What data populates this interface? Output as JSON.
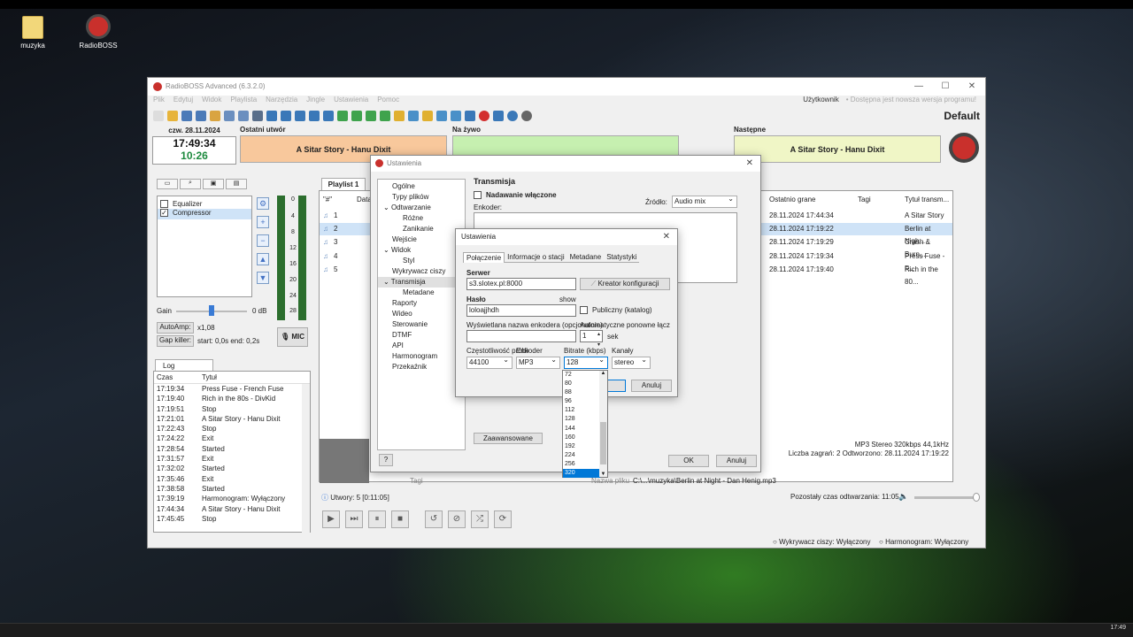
{
  "desktop": {
    "icons": [
      {
        "label": "muzyka"
      },
      {
        "label": "RadioBOSS"
      }
    ]
  },
  "taskbar": {
    "time": "17:49"
  },
  "app": {
    "title": "RadioBOSS Advanced (6.3.2.0)",
    "menu": [
      "Plik",
      "Edytuj",
      "Widok",
      "Playlista",
      "Narzędzia",
      "Jingle",
      "Ustawienia",
      "Pomoc"
    ],
    "user": "Użytkownik",
    "update": "• Dostępna jest nowsza wersja programu!",
    "profile": "Default",
    "date": "czw. 28.11.2024",
    "time": "17:49:34",
    "countdown": "10:26",
    "last_label": "Ostatni utwór",
    "last_track": "A Sitar Story - Hanu Dixit",
    "live_label": "Na żywo",
    "live_track": "",
    "next_label": "Następne",
    "next_track": "A Sitar Story - Hanu Dixit",
    "effects": [
      {
        "name": "Equalizer",
        "checked": false
      },
      {
        "name": "Compressor",
        "checked": true
      }
    ],
    "gain_label": "Gain",
    "gain_value": "0 dB",
    "autoamp_label": "AutoAmp:",
    "autoamp_value": "x1,08",
    "gapkiller_label": "Gap killer:",
    "gapkiller_value": "start: 0,0s end: 0,2s",
    "mic_label": "MIC",
    "meter_scale": [
      "0",
      "4",
      "8",
      "12",
      "16",
      "20",
      "24",
      "28"
    ],
    "log": {
      "tab": "Log",
      "col_time": "Czas",
      "col_title": "Tytuł",
      "rows": [
        {
          "t": "17:19:34",
          "v": "Press Fuse - French Fuse"
        },
        {
          "t": "17:19:40",
          "v": "Rich in the 80s - DivKid"
        },
        {
          "t": "17:19:51",
          "v": "Stop"
        },
        {
          "t": "17:21:01",
          "v": "A Sitar Story - Hanu Dixit"
        },
        {
          "t": "17:22:43",
          "v": "Stop"
        },
        {
          "t": "17:24:22",
          "v": "Exit"
        },
        {
          "t": "17:28:54",
          "v": "Started"
        },
        {
          "t": "17:31:57",
          "v": "Exit"
        },
        {
          "t": "17:32:02",
          "v": "Started"
        },
        {
          "t": "17:35:46",
          "v": "Exit"
        },
        {
          "t": "17:38:58",
          "v": "Started"
        },
        {
          "t": "17:39:19",
          "v": "Harmonogram: Wyłączony"
        },
        {
          "t": "17:44:34",
          "v": "A Sitar Story - Hanu Dixit"
        },
        {
          "t": "17:45:45",
          "v": "Stop"
        }
      ]
    },
    "playlist": {
      "tab": "Playlist 1",
      "col_num": "\"#\"",
      "col_data": "Data",
      "rows": [
        "1",
        "2",
        "3",
        "4",
        "5"
      ],
      "col_last": "Ostatnio grane",
      "col_tags": "Tagi",
      "col_title": "Tytuł transm...",
      "played": [
        {
          "d": "28.11.2024 17:44:34",
          "t": "A Sitar Story -..."
        },
        {
          "d": "28.11.2024 17:19:22",
          "t": "Berlin at Nigh..."
        },
        {
          "d": "28.11.2024 17:19:29",
          "t": "Crash & Burn..."
        },
        {
          "d": "28.11.2024 17:19:34",
          "t": "Press Fuse - F..."
        },
        {
          "d": "28.11.2024 17:19:40",
          "t": "Rich in the 80..."
        }
      ],
      "info1": "MP3 Stereo 320kbps 44,1kHz",
      "info2": "Liczba zagrań: 2  Odtworzono: 28.11.2024 17:19:22",
      "tags_label": "Tagi",
      "file_label": "Nazwa pliku",
      "file_path": "C:\\...\\muzyka\\Berlin at Night - Dan Henig.mp3"
    },
    "status": {
      "tracks": "Utwory: 5 [0:11:05]",
      "remaining": "Pozostały czas odtwarzania: 11:05",
      "silence": "Wykrywacz ciszy: Wyłączony",
      "schedule": "Harmonogram: Wyłączony"
    }
  },
  "settings": {
    "title": "Ustawienia",
    "tree": [
      "Ogólne",
      "Typy plików",
      "Odtwarzanie",
      "Różne",
      "Zanikanie",
      "Wejście",
      "Widok",
      "Styl",
      "Wykrywacz ciszy",
      "Transmisja",
      "Metadane",
      "Raporty",
      "Wideo",
      "Sterowanie",
      "DTMF",
      "API",
      "Harmonogram",
      "Przekaźnik"
    ],
    "section": "Transmisja",
    "enable_label": "Nadawanie włączone",
    "source_label": "Źródło:",
    "source_value": "Audio mix",
    "encoder_label": "Enkoder:",
    "advanced": "Zaawansowane",
    "help": "?",
    "ok": "OK",
    "cancel": "Anuluj"
  },
  "encoder": {
    "title": "Ustawienia",
    "tabs": [
      "Połączenie",
      "Informacje o stacji",
      "Metadane",
      "Statystyki"
    ],
    "server_label": "Serwer",
    "server_value": "s3.slotex.pl:8000",
    "wizard": "Kreator konfiguracji",
    "password_label": "Hasło",
    "password_value": "loloajjhdh",
    "show": "show",
    "public_label": "Publiczny (katalog)",
    "name_label": "Wyświetlana nazwa enkodera (opcjonalnie)",
    "reconnect_label": "Automatyczne ponowne łącz",
    "reconnect_value": "1",
    "reconnect_unit": "sek",
    "freq_label": "Częstotliwość próbkowania",
    "freq_value": "44100",
    "enc_label": "Enkoder",
    "enc_value": "MP3",
    "bitrate_label": "Bitrate (kbps)",
    "bitrate_value": "128",
    "channels_label": "Kanały",
    "channels_value": "stereo",
    "cancel": "Anuluj",
    "bitrates": [
      "72",
      "80",
      "88",
      "96",
      "112",
      "128",
      "144",
      "160",
      "192",
      "224",
      "256",
      "320"
    ],
    "bitrate_highlight": "320"
  }
}
